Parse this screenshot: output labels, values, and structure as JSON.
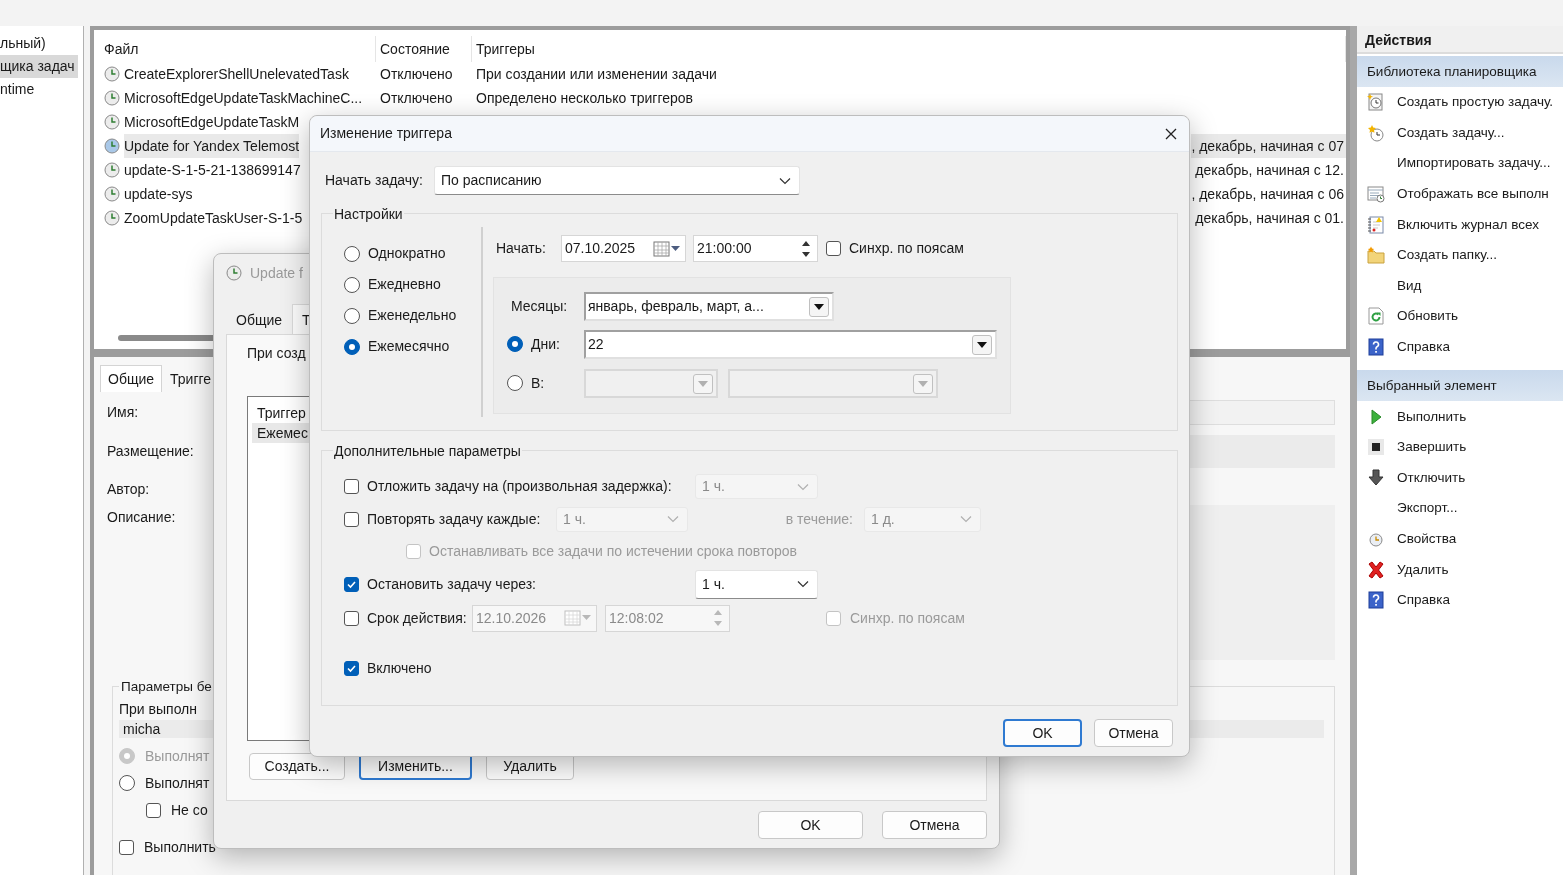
{
  "nav_tree": {
    "items": [
      {
        "label": "льный)",
        "selected": false
      },
      {
        "label": "щика задач",
        "selected": true
      },
      {
        "label": "ntime",
        "selected": false
      }
    ]
  },
  "task_list": {
    "columns": [
      "Файл",
      "Состояние",
      "Триггеры"
    ],
    "rows": [
      {
        "name": "CreateExplorerShellUnelevatedTask",
        "state": "Отключено",
        "trigger": "При создании или изменении задачи",
        "selected": false
      },
      {
        "name": "MicrosoftEdgeUpdateTaskMachineC...",
        "state": "Отключено",
        "trigger": "Определено несколько триггеров",
        "selected": false
      },
      {
        "name": "MicrosoftEdgeUpdateTaskM",
        "selected": false
      },
      {
        "name": "Update for Yandex Telemost",
        "trigger_tail": ", декабрь, начиная с 07",
        "selected": true
      },
      {
        "name": "update-S-1-5-21-138699147",
        "trigger_tail": "декабрь, начиная с 12.",
        "selected": false
      },
      {
        "name": "update-sys",
        "trigger_tail": ", декабрь, начиная с 06",
        "selected": false
      },
      {
        "name": "ZoomUpdateTaskUser-S-1-5",
        "trigger_tail": "декабрь, начиная с 01.",
        "selected": false
      }
    ]
  },
  "details": {
    "tabs": [
      {
        "label": "Общие",
        "selected": true
      },
      {
        "label": "Тригге",
        "selected": false
      }
    ],
    "fields": [
      {
        "label": "Имя:",
        "kind": "input"
      },
      {
        "label": "Размещение:",
        "kind": "readonly"
      },
      {
        "label": "Автор:",
        "kind": "none"
      },
      {
        "label": "Описание:",
        "kind": "area"
      }
    ],
    "security": {
      "title": "Параметры бе",
      "run_as_label": "При выполн",
      "user": "micha",
      "options": [
        {
          "kind": "radio",
          "label": "Выполнят",
          "checked": true,
          "disabled": true
        },
        {
          "kind": "radio",
          "label": "Выполнят",
          "checked": false,
          "disabled": false,
          "children": [
            {
              "kind": "checkbox",
              "label": "Не со",
              "checked": false,
              "disabled": false
            }
          ]
        },
        {
          "kind": "checkbox",
          "label": "Выполнить",
          "checked": false,
          "disabled": false
        }
      ]
    }
  },
  "properties_dialog": {
    "title": "Update f",
    "tabs": [
      {
        "label": "Общие",
        "selected": false
      },
      {
        "label": "Т",
        "selected": true
      }
    ],
    "intro": "При созд",
    "list": {
      "column": "Триггер",
      "rows": [
        {
          "text": "Ежемес",
          "selected": true
        }
      ]
    },
    "buttons": [
      {
        "label": "Создать...",
        "default": false
      },
      {
        "label": "Изменить...",
        "default": true
      },
      {
        "label": "Удалить",
        "default": false
      }
    ],
    "footer_buttons": [
      {
        "label": "OK",
        "default": false
      },
      {
        "label": "Отмена",
        "default": false
      }
    ]
  },
  "trigger_dialog": {
    "title": "Изменение триггера",
    "begin_task": {
      "label": "Начать задачу:",
      "value": "По расписанию"
    },
    "settings": {
      "title": "Настройки",
      "schedules": [
        {
          "label": "Однократно",
          "selected": false
        },
        {
          "label": "Ежедневно",
          "selected": false
        },
        {
          "label": "Еженедельно",
          "selected": false
        },
        {
          "label": "Ежемесячно",
          "selected": true
        }
      ],
      "start": {
        "label": "Начать:",
        "date": "07.10.2025",
        "time": "21:00:00",
        "sync": {
          "label": "Синхр. по поясам",
          "checked": false
        }
      },
      "months": {
        "label": "Месяцы:",
        "value": "январь, февраль, март, а..."
      },
      "day_modes": [
        {
          "label": "Дни:",
          "selected": true,
          "value": "22"
        },
        {
          "label": "В:",
          "selected": false
        }
      ]
    },
    "advanced": {
      "title": "Дополнительные параметры",
      "options": [
        {
          "kind": "delay",
          "label": "Отложить задачу на (произвольная задержка):",
          "checked": false,
          "value": "1 ч."
        },
        {
          "kind": "repeat",
          "label": "Повторять задачу каждые:",
          "checked": false,
          "value": "1 ч.",
          "duration_label": "в течение:",
          "duration": "1 д."
        },
        {
          "kind": "stop-all",
          "label": "Останавливать все задачи по истечении срока повторов",
          "checked": false
        },
        {
          "kind": "stop-after",
          "label": "Остановить задачу через:",
          "checked": true,
          "value": "1 ч."
        },
        {
          "kind": "expire",
          "label": "Срок действия:",
          "checked": false,
          "date": "12.10.2026",
          "time": "12:08:02",
          "sync_label": "Синхр. по поясам",
          "sync_checked": false
        },
        {
          "kind": "enabled",
          "label": "Включено",
          "checked": true
        }
      ]
    },
    "buttons": [
      {
        "label": "OK",
        "default": true
      },
      {
        "label": "Отмена",
        "default": false
      }
    ]
  },
  "actions_pane": {
    "title": "Действия",
    "sections": [
      {
        "title": "Библиотека планировщика",
        "items": [
          {
            "label": "Создать простую задачу.",
            "kind": "wizard"
          },
          {
            "label": "Создать задачу...",
            "kind": "new-task"
          },
          {
            "label": "Импортировать задачу...",
            "kind": "none"
          },
          {
            "label": "Отображать все выполн",
            "kind": "list"
          },
          {
            "label": "Включить журнал всех",
            "kind": "log"
          },
          {
            "label": "Создать папку...",
            "kind": "folder"
          },
          {
            "label": "Вид",
            "kind": "none"
          },
          {
            "label": "Обновить",
            "kind": "refresh"
          },
          {
            "label": "Справка",
            "kind": "help"
          }
        ]
      },
      {
        "title": "Выбранный элемент",
        "items": [
          {
            "label": "Выполнить",
            "kind": "run"
          },
          {
            "label": "Завершить",
            "kind": "stop"
          },
          {
            "label": "Отключить",
            "kind": "disable"
          },
          {
            "label": "Экспорт...",
            "kind": "none"
          },
          {
            "label": "Свойства",
            "kind": "properties"
          },
          {
            "label": "Удалить",
            "kind": "delete"
          },
          {
            "label": "Справка",
            "kind": "help"
          }
        ]
      }
    ]
  }
}
